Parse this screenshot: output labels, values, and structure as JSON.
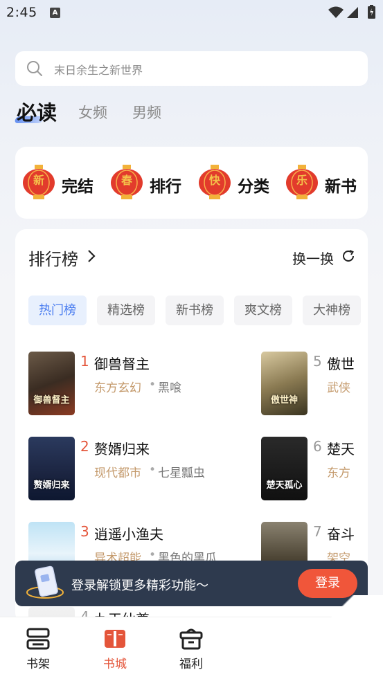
{
  "status_bar": {
    "time": "2:45",
    "notification_icon": "a-icon"
  },
  "search": {
    "placeholder": "末日余生之新世界"
  },
  "tabs": [
    {
      "label": "必读",
      "active": true
    },
    {
      "label": "女频",
      "active": false
    },
    {
      "label": "男频",
      "active": false
    }
  ],
  "categories": [
    {
      "lantern": "新",
      "label": "完结"
    },
    {
      "lantern": "春",
      "label": "排行"
    },
    {
      "lantern": "快",
      "label": "分类"
    },
    {
      "lantern": "乐",
      "label": "新书"
    }
  ],
  "ranking": {
    "title": "排行榜",
    "refresh_label": "换一换",
    "chips": [
      "热门榜",
      "精选榜",
      "新书榜",
      "爽文榜",
      "大神榜"
    ],
    "active_chip": "热门榜",
    "books": [
      {
        "rank": "1",
        "title": "御兽督主",
        "genre": "东方玄幻",
        "author": "黑喰",
        "cover_text": "御兽督主"
      },
      {
        "rank": "2",
        "title": "赘婿归来",
        "genre": "现代都市",
        "author": "七星瓢虫",
        "cover_text": "赘婿归来"
      },
      {
        "rank": "3",
        "title": "逍遥小渔夫",
        "genre": "异术超能",
        "author": "黑色的黑瓜",
        "cover_text": ""
      },
      {
        "rank": "4",
        "title": "九天仙尊",
        "genre": "",
        "author": "",
        "cover_text": ""
      },
      {
        "rank": "5",
        "title": "傲世",
        "genre": "武侠",
        "author": "",
        "cover_text": "傲世神"
      },
      {
        "rank": "6",
        "title": "楚天",
        "genre": "东方",
        "author": "",
        "cover_text": "楚天孤心"
      },
      {
        "rank": "7",
        "title": "奋斗",
        "genre": "架空",
        "author": "",
        "cover_text": ""
      }
    ],
    "separator": "•"
  },
  "login_banner": {
    "text": "登录解锁更多精彩功能～",
    "button": "登录"
  },
  "bottom_nav": [
    {
      "label": "书架",
      "icon": "bookshelf-icon",
      "active": false
    },
    {
      "label": "书城",
      "icon": "bookstore-icon",
      "active": true
    },
    {
      "label": "福利",
      "icon": "gift-icon",
      "active": false
    }
  ],
  "colors": {
    "accent_red": "#e4553a",
    "accent_blue": "#4a7df0",
    "genre_brown": "#c49a6c",
    "banner_bg": "#2e3a4e"
  }
}
